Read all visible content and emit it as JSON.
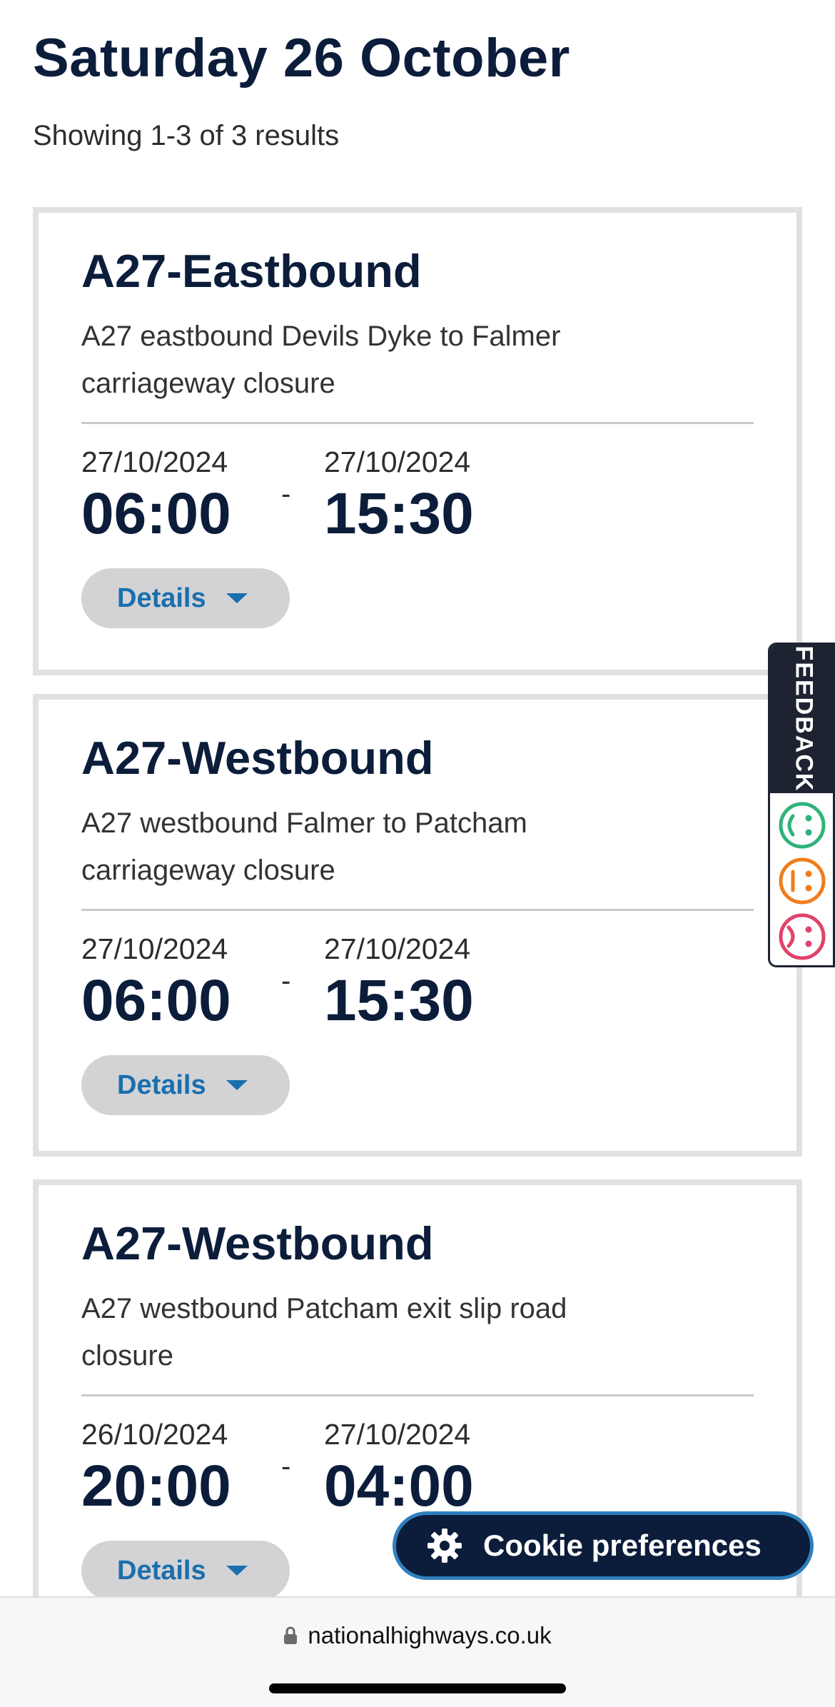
{
  "page": {
    "title": "Saturday 26 October",
    "results_count": "Showing 1-3 of 3 results"
  },
  "closures": [
    {
      "title": "A27-Eastbound",
      "description": "A27 eastbound Devils Dyke to Falmer carriageway closure",
      "start_date": "27/10/2024",
      "start_time": "06:00",
      "separator": "-",
      "end_date": "27/10/2024",
      "end_time": "15:30",
      "details_label": "Details"
    },
    {
      "title": "A27-Westbound",
      "description": "A27 westbound Falmer to Patcham carriageway closure",
      "start_date": "27/10/2024",
      "start_time": "06:00",
      "separator": "-",
      "end_date": "27/10/2024",
      "end_time": "15:30",
      "details_label": "Details"
    },
    {
      "title": "A27-Westbound",
      "description": "A27 westbound Patcham exit slip road closure",
      "start_date": "26/10/2024",
      "start_time": "20:00",
      "separator": "-",
      "end_date": "27/10/2024",
      "end_time": "04:00",
      "details_label": "Details"
    }
  ],
  "feedback": {
    "label": "FEEDBACK",
    "icons": [
      "happy-face-icon",
      "neutral-face-icon",
      "sad-face-icon"
    ],
    "colors": {
      "happy": "#2fb37a",
      "neutral": "#f07d1c",
      "sad": "#e0436b"
    }
  },
  "cookie": {
    "label": "Cookie preferences",
    "icon": "gear-icon"
  },
  "browser": {
    "url": "nationalhighways.co.uk",
    "icon": "lock-icon"
  },
  "colors": {
    "heading": "#0b1d3a",
    "link": "#1a6fae",
    "button_bg": "#d3d3d5",
    "card_border": "#e1e1e3"
  }
}
